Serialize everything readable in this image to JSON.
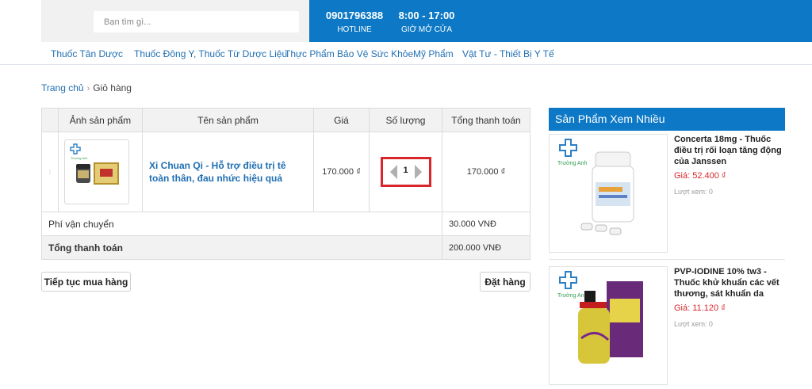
{
  "header": {
    "search_placeholder": "Bạn tìm gì...",
    "hotline_number": "0901796388",
    "hotline_label": "HOTLINE",
    "hours_value": "8:00 - 17:00",
    "hours_label": "GIỜ MỞ CỬA"
  },
  "nav": {
    "items": [
      "Thuốc Tân Dược",
      "Thuốc Đông Y, Thuốc Từ Dược Liệu",
      "Thực Phẩm Bảo Vệ Sức Khỏe",
      "Mỹ Phẩm",
      "Vật Tư - Thiết Bị Y Tế"
    ]
  },
  "breadcrumb": {
    "home": "Trang chủ",
    "separator": "›",
    "current": "Giỏ hàng"
  },
  "cart": {
    "columns": [
      "Ảnh sản phẩm",
      "Tên sản phẩm",
      "Giá",
      "Số lượng",
      "Tổng thanh toán"
    ],
    "items": [
      {
        "name": "Xi Chuan Qi - Hỗ trợ điều trị tê toàn thân, đau nhức hiệu quả",
        "price": "170.000 ₫",
        "quantity": "1",
        "total": "170.000 ₫",
        "thumb_brand": "Trường Anh"
      }
    ],
    "shipping_label": "Phí vận chuyển",
    "shipping_value": "30.000 VNĐ",
    "total_label": "Tổng thanh toán",
    "total_value": "200.000 VNĐ",
    "continue_button": "Tiếp tục mua hàng",
    "order_button": "Đặt hàng"
  },
  "sidebar": {
    "title": "Sản Phẩm Xem Nhiều",
    "products": [
      {
        "title": "Concerta 18mg - Thuốc điều trị rối loạn tăng động của Janssen",
        "price": "Giá: 52.400 ₫",
        "views": "Lượt xem: 0",
        "brand": "Trường Anh"
      },
      {
        "title": "PVP-IODINE 10% tw3 - Thuốc khử khuẩn các vết thương, sát khuẩn da",
        "price": "Giá: 11.120 ₫",
        "views": "Lượt xem: 0",
        "brand": "Trường Anh"
      }
    ]
  },
  "colors": {
    "brand_blue": "#0d79c6",
    "link_blue": "#1f6fb2",
    "price_red": "#d9262c",
    "highlight_red": "#d9262c"
  }
}
